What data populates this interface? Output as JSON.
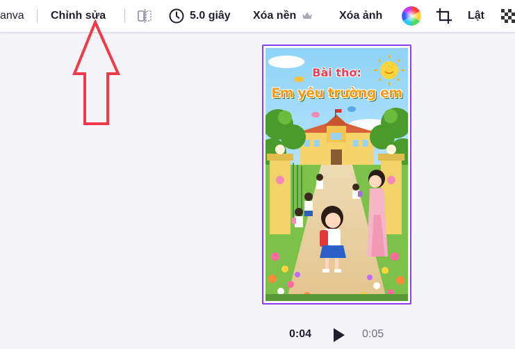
{
  "toolbar": {
    "brand_fragment": "anva",
    "edit_label": "Chỉnh sửa",
    "duration_label": "5.0 giây",
    "remove_bg_label": "Xóa nền",
    "remove_image_label": "Xóa ảnh",
    "flip_label": "Lật",
    "icons": [
      "flip-split-icon",
      "clock-icon",
      "crown-icon",
      "color-wheel-icon",
      "crop-icon",
      "transparency-icon"
    ]
  },
  "poster": {
    "title_line1": "Bài thơ:",
    "title_line2": "Em yêu trường em"
  },
  "playback": {
    "current_time": "0:04",
    "total_time": "0:05"
  },
  "colors": {
    "selection_border": "#8b3dff",
    "annotation_arrow": "#f03a4a",
    "canvas_bg": "#f4f4f9"
  }
}
